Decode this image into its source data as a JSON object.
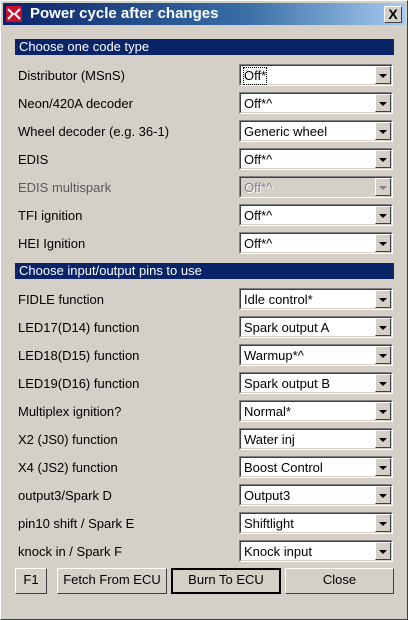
{
  "window": {
    "title": "Power cycle after changes",
    "close_label": "X"
  },
  "sections": [
    {
      "header": "Choose one code type"
    },
    {
      "header": "Choose input/output pins to use"
    }
  ],
  "code_type_rows": [
    {
      "label": "Distributor (MSnS)",
      "value": "Off*",
      "focused": true,
      "disabled": false
    },
    {
      "label": "Neon/420A decoder",
      "value": "Off*^",
      "focused": false,
      "disabled": false
    },
    {
      "label": "Wheel decoder (e.g. 36-1)",
      "value": "Generic wheel",
      "focused": false,
      "disabled": false
    },
    {
      "label": "EDIS",
      "value": "Off*^",
      "focused": false,
      "disabled": false
    },
    {
      "label": "EDIS multispark",
      "value": "Off*^",
      "focused": false,
      "disabled": true
    },
    {
      "label": "TFI ignition",
      "value": "Off*^",
      "focused": false,
      "disabled": false
    },
    {
      "label": "HEI Ignition",
      "value": "Off*^",
      "focused": false,
      "disabled": false
    }
  ],
  "pin_rows": [
    {
      "label": "FIDLE function",
      "value": "Idle control*"
    },
    {
      "label": "LED17(D14) function",
      "value": "Spark output A"
    },
    {
      "label": "LED18(D15) function",
      "value": "Warmup*^"
    },
    {
      "label": "LED19(D16) function",
      "value": "Spark output B"
    },
    {
      "label": "Multiplex ignition?",
      "value": "Normal*"
    },
    {
      "label": "X2 (JS0) function",
      "value": "Water inj"
    },
    {
      "label": "X4 (JS2) function",
      "value": "Boost Control"
    },
    {
      "label": "output3/Spark D",
      "value": "Output3"
    },
    {
      "label": "pin10 shift / Spark E",
      "value": "Shiftlight"
    },
    {
      "label": "knock in / Spark F",
      "value": "Knock input"
    }
  ],
  "buttons": {
    "f1": "F1",
    "fetch": "Fetch From ECU",
    "burn": "Burn To ECU",
    "close": "Close"
  }
}
